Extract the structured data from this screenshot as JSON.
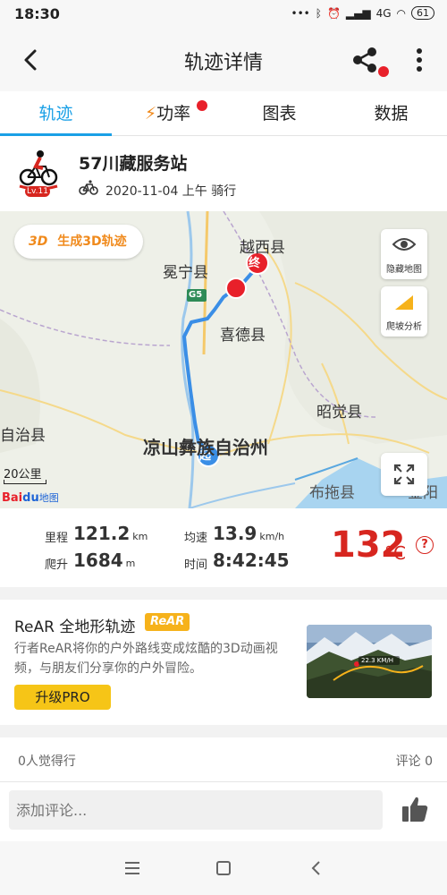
{
  "status": {
    "time": "18:30",
    "signal_text": "4G",
    "battery": "61"
  },
  "topbar": {
    "title": "轨迹详情"
  },
  "tabs": [
    {
      "label": "轨迹"
    },
    {
      "label": "功率"
    },
    {
      "label": "图表"
    },
    {
      "label": "数据"
    }
  ],
  "header": {
    "name": "57川藏服务站",
    "level": "Lv.11",
    "meta": "2020-11-04 上午 骑行"
  },
  "map": {
    "btn_3d_prefix": "3D",
    "btn_3d_label": "生成3D轨迹",
    "hide_map_label": "隐藏地图",
    "slope_label": "爬坡分析",
    "scale_label": "20公里",
    "brand_bai": "Bai",
    "brand_du": "du",
    "brand_ditu": "地图",
    "start_marker": "起",
    "end_marker": "终",
    "places": [
      "越西县",
      "冕宁县",
      "G5",
      "喜德县",
      "昭觉县",
      "自治县",
      "凉山彝族自治州",
      "布拖县",
      "金阳"
    ]
  },
  "stats": {
    "distance_label": "里程",
    "distance": "121.2",
    "distance_unit": "km",
    "climb_label": "爬升",
    "climb": "1684",
    "climb_unit": "m",
    "speed_label": "均速",
    "speed": "13.9",
    "speed_unit": "km/h",
    "time_label": "时间",
    "time": "8:42:45",
    "temperature": "132",
    "temperature_unit": "°C",
    "help": "?"
  },
  "rear": {
    "title": "ReAR 全地形轨迹",
    "badge": "ReAR",
    "description": "行者ReAR将你的户外路线变成炫酷的3D动画视频，与朋友们分享你的户外冒险。",
    "upgrade_label": "升级PRO",
    "preview_text": "22.3 KM/H"
  },
  "social": {
    "likes": "0人觉得行",
    "comments": "评论 0"
  },
  "comment": {
    "placeholder": "添加评论..."
  },
  "colors": {
    "accent": "#1aa0e6",
    "temperature": "#d7261f",
    "upgrade": "#f6c517",
    "route": "#3a8ee6"
  }
}
